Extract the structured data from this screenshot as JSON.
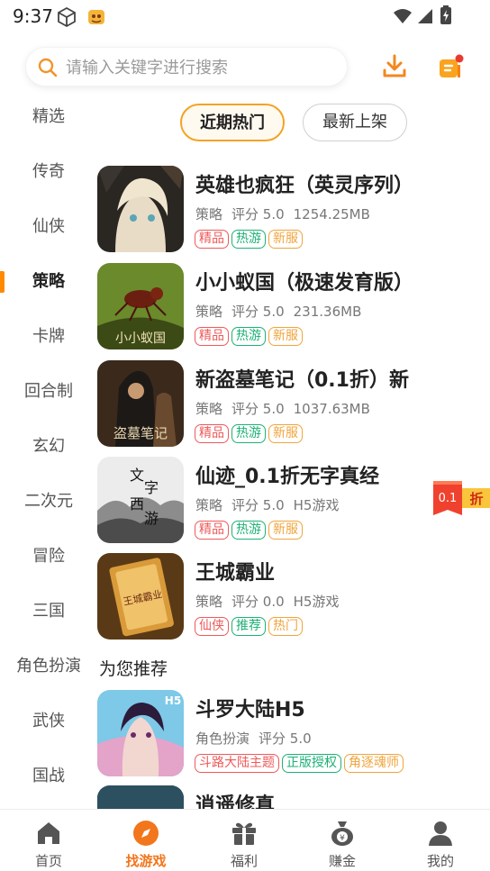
{
  "status_bar": {
    "time": "9:37"
  },
  "search": {
    "placeholder": "请输入关键字进行搜索"
  },
  "sidebar": {
    "items": [
      "精选",
      "传奇",
      "仙侠",
      "策略",
      "卡牌",
      "回合制",
      "玄幻",
      "二次元",
      "冒险",
      "三国",
      "角色扮演",
      "武侠",
      "国战"
    ],
    "active": "策略"
  },
  "tabs": {
    "hot": "近期热门",
    "new": "最新上架"
  },
  "games": [
    {
      "name": "英雄也疯狂（英灵序列）",
      "category": "策略",
      "rating": "评分 5.0",
      "size": "1254.25MB",
      "tags": [
        "精品",
        "热游",
        "新服"
      ]
    },
    {
      "name": "小小蚁国（极速发育版）",
      "category": "策略",
      "rating": "评分 5.0",
      "size": "231.36MB",
      "tags": [
        "精品",
        "热游",
        "新服"
      ]
    },
    {
      "name": "新盗墓笔记（0.1折）新",
      "category": "策略",
      "rating": "评分 5.0",
      "size": "1037.63MB",
      "tags": [
        "精品",
        "热游",
        "新服"
      ]
    },
    {
      "name": "仙迹_0.1折无字真经",
      "category": "策略",
      "rating": "评分 5.0",
      "size": "H5游戏",
      "tags": [
        "精品",
        "热游",
        "新服"
      ]
    },
    {
      "name": "王城霸业",
      "category": "策略",
      "rating": "评分 0.0",
      "size": "H5游戏",
      "tags": [
        "仙侠",
        "推荐",
        "热门"
      ]
    }
  ],
  "recommend": {
    "title": "为您推荐",
    "games": [
      {
        "name": "斗罗大陆H5",
        "category": "角色扮演",
        "rating": "评分 5.0",
        "tags": [
          "斗路大陆主题",
          "正版授权",
          "角逐魂师"
        ]
      },
      {
        "name": "逍遥修真"
      }
    ]
  },
  "thumb_text": {
    "game2": "小小蚁国",
    "game3": "盗墓笔记",
    "game4_1": "文",
    "game4_2": "字",
    "game4_3": "西",
    "game4_4": "游",
    "game5": "王城霸业",
    "rec1_badge": "H5"
  },
  "discount": {
    "value": "0.1",
    "label": "折"
  },
  "nav": {
    "items": [
      "首页",
      "找游戏",
      "福利",
      "赚金",
      "我的"
    ],
    "active": "找游戏",
    "coin_symbol": "¥"
  },
  "colors": {
    "accent": "#f2761c",
    "tag_red": "#ee5a5a",
    "tag_green": "#1db176",
    "tag_orange": "#f0a43c"
  }
}
